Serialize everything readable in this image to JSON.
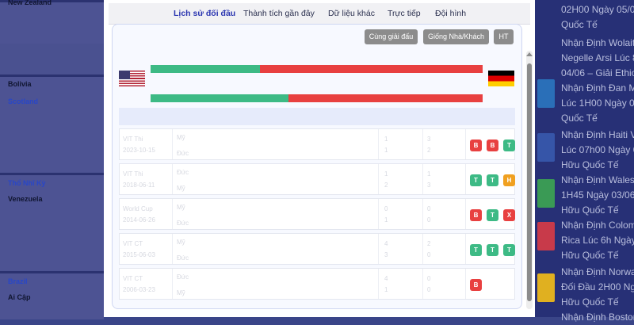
{
  "left_panel": {
    "teams": [
      "New Zealand",
      "Bolivia",
      "Scotland",
      "Thổ Nhĩ Kỳ",
      "Venezuela",
      "Brazil",
      "Ai Cập"
    ]
  },
  "right_panel": {
    "lines": [
      "02H00 Ngày 05/0",
      "Quốc Tế",
      "Nhận Định Wolait",
      "Negelle Arsi Lúc 8",
      "04/06 – Giải Ethiop",
      "Nhận Định Đan M",
      "Lúc 1H00 Ngày 04",
      "Quốc Tế",
      "Nhận Định Haiti V",
      "Lúc 07h00 Ngày 0",
      "Hữu Quốc Tế",
      "Nhận Định Wales",
      "1H45 Ngày 03/06",
      "Hữu Quốc Tế",
      "Nhận Định Colomb",
      "Rica Lúc 6h Ngày",
      "Hữu Quốc Tế",
      "Nhận Định Norwa",
      "Đối Đầu 2H00 Ngà",
      "Hữu Quốc Tế",
      "Nhận Định Bostor"
    ]
  },
  "modal": {
    "tabs": [
      "Lịch sử đối đầu",
      "Thành tích gần đây",
      "Dữ liệu khác",
      "Trực tiếp",
      "Đội hình"
    ],
    "filters": {
      "same_league": "Cùng giải đấu",
      "same_home_away": "Giống Nhà/Khách",
      "ht": "HT"
    },
    "home_flag": "us-flag",
    "away_flag": "germany-flag",
    "bars": [
      {
        "win_fraction": 0.33,
        "caption_left": "",
        "caption_right": ""
      },
      {
        "win_fraction": 0.415,
        "caption_left": "",
        "caption_right": ""
      }
    ],
    "colors": {
      "green": "#3dba85",
      "red": "#e84040",
      "orange": "#f0a020",
      "gray_button": "#8c8c8c"
    },
    "rows": [
      {
        "league": "VIT Thi",
        "date": "2023-10-15",
        "team1": "Mỹ",
        "team2": "Đức",
        "s1": "1",
        "s2": "1",
        "h1": "3",
        "h2": "2",
        "badges": [
          "B",
          "B",
          "T"
        ]
      },
      {
        "league": "VIT Thi",
        "date": "2018-06-11",
        "team1": "Đức",
        "team2": "Mỹ",
        "s1": "1",
        "s2": "2",
        "h1": "1",
        "h2": "3",
        "badges": [
          "T",
          "T",
          "H"
        ]
      },
      {
        "league": "World Cup",
        "date": "2014-06-26",
        "team1": "Mỹ",
        "team2": "Đức",
        "s1": "0",
        "s2": "1",
        "h1": "0",
        "h2": "0",
        "badges": [
          "B",
          "T",
          "X"
        ]
      },
      {
        "league": "VIT CT",
        "date": "2015-06-03",
        "team1": "Mỹ",
        "team2": "Đức",
        "s1": "4",
        "s2": "3",
        "h1": "2",
        "h2": "0",
        "badges": [
          "T",
          "T",
          "T"
        ]
      },
      {
        "league": "VIT CT",
        "date": "2006-03-23",
        "team1": "Đức",
        "team2": "Mỹ",
        "s1": "4",
        "s2": "1",
        "h1": "0",
        "h2": "0",
        "badges": [
          "B"
        ]
      }
    ]
  }
}
